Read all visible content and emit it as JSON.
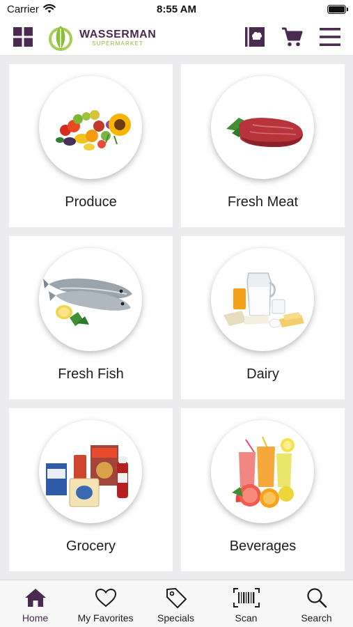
{
  "status_bar": {
    "carrier": "Carrier",
    "time": "8:55 AM"
  },
  "header": {
    "logo_name": "WASSERMAN",
    "logo_sub": "SUPERMARKET",
    "brand_color": "#4a2a50",
    "accent_color": "#8dbb3b",
    "icons": [
      "grid-menu-icon",
      "recipes-book-icon",
      "cart-icon",
      "hamburger-menu-icon"
    ]
  },
  "categories": [
    {
      "label": "Produce",
      "image": "produce-image"
    },
    {
      "label": "Fresh Meat",
      "image": "fresh-meat-image"
    },
    {
      "label": "Fresh Fish",
      "image": "fresh-fish-image"
    },
    {
      "label": "Dairy",
      "image": "dairy-image"
    },
    {
      "label": "Grocery",
      "image": "grocery-image"
    },
    {
      "label": "Beverages",
      "image": "beverages-image"
    }
  ],
  "tabbar": {
    "active": "Home",
    "tabs": [
      {
        "label": "Home",
        "icon": "home-icon"
      },
      {
        "label": "My Favorites",
        "icon": "heart-icon"
      },
      {
        "label": "Specials",
        "icon": "tag-icon"
      },
      {
        "label": "Scan",
        "icon": "barcode-icon"
      },
      {
        "label": "Search",
        "icon": "search-icon"
      }
    ]
  }
}
